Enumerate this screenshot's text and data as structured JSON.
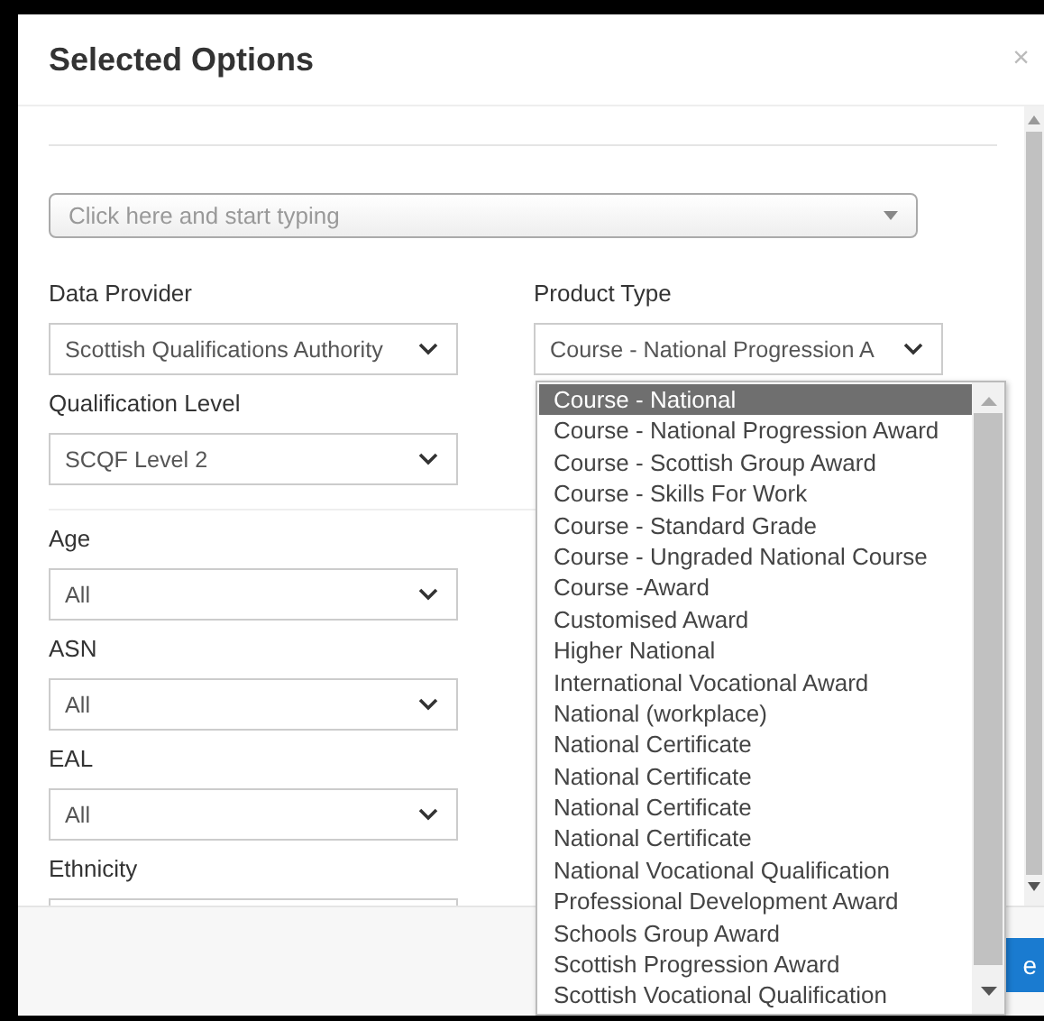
{
  "dialog": {
    "title": "Selected Options",
    "close": "×"
  },
  "search": {
    "placeholder": "Click here and start typing"
  },
  "sections": [
    {
      "fields": [
        {
          "label": "Data Provider",
          "value": "Scottish Qualifications Authority"
        },
        {
          "label": "Product Type",
          "value": "Course - National Progression A"
        },
        {
          "label": "Qualification Level",
          "value": "SCQF Level 2"
        }
      ]
    },
    {
      "fields": [
        {
          "label": "Age",
          "value": "All"
        },
        {
          "label": "ASN",
          "value": "All"
        },
        {
          "label": "EAL",
          "value": "All"
        },
        {
          "label": "Ethnicity"
        }
      ]
    }
  ],
  "product_type_options": [
    {
      "label": "Course - National",
      "selected": true
    },
    {
      "label": "Course - National Progression Award",
      "selected": false
    },
    {
      "label": "Course - Scottish Group Award",
      "selected": false
    },
    {
      "label": "Course - Skills For Work",
      "selected": false
    },
    {
      "label": "Course - Standard Grade",
      "selected": false
    },
    {
      "label": "Course - Ungraded National Course",
      "selected": false
    },
    {
      "label": "Course -Award",
      "selected": false
    },
    {
      "label": "Customised Award",
      "selected": false
    },
    {
      "label": "Higher National",
      "selected": false
    },
    {
      "label": "International Vocational Award",
      "selected": false
    },
    {
      "label": "National (workplace)",
      "selected": false
    },
    {
      "label": "National Certificate",
      "selected": false
    },
    {
      "label": "National Certificate",
      "selected": false
    },
    {
      "label": "National Certificate",
      "selected": false
    },
    {
      "label": "National Certificate",
      "selected": false
    },
    {
      "label": "National Vocational Qualification",
      "selected": false
    },
    {
      "label": "Professional Development Award",
      "selected": false
    },
    {
      "label": "Schools Group Award",
      "selected": false
    },
    {
      "label": "Scottish Progression Award",
      "selected": false
    },
    {
      "label": "Scottish Vocational Qualification",
      "selected": false
    }
  ],
  "footer": {
    "button": "e"
  }
}
